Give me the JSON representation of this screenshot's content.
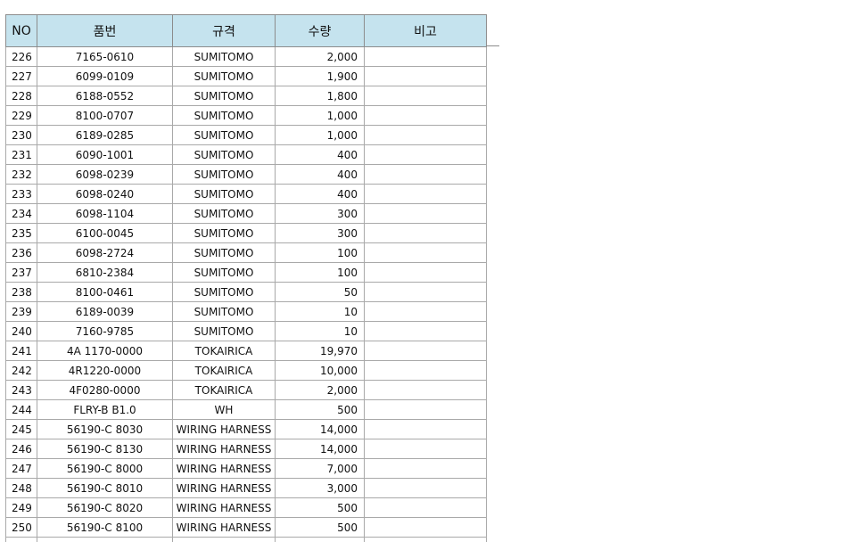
{
  "table": {
    "headers": {
      "no": "NO",
      "part": "품번",
      "spec": "규격",
      "qty": "수량",
      "note": "비고"
    },
    "rows": [
      {
        "no": "226",
        "part": "7165-0610",
        "spec": "SUMITOMO",
        "qty": "2,000",
        "note": ""
      },
      {
        "no": "227",
        "part": "6099-0109",
        "spec": "SUMITOMO",
        "qty": "1,900",
        "note": ""
      },
      {
        "no": "228",
        "part": "6188-0552",
        "spec": "SUMITOMO",
        "qty": "1,800",
        "note": ""
      },
      {
        "no": "229",
        "part": "8100-0707",
        "spec": "SUMITOMO",
        "qty": "1,000",
        "note": ""
      },
      {
        "no": "230",
        "part": "6189-0285",
        "spec": "SUMITOMO",
        "qty": "1,000",
        "note": ""
      },
      {
        "no": "231",
        "part": "6090-1001",
        "spec": "SUMITOMO",
        "qty": "400",
        "note": ""
      },
      {
        "no": "232",
        "part": "6098-0239",
        "spec": "SUMITOMO",
        "qty": "400",
        "note": ""
      },
      {
        "no": "233",
        "part": "6098-0240",
        "spec": "SUMITOMO",
        "qty": "400",
        "note": ""
      },
      {
        "no": "234",
        "part": "6098-1104",
        "spec": "SUMITOMO",
        "qty": "300",
        "note": ""
      },
      {
        "no": "235",
        "part": "6100-0045",
        "spec": "SUMITOMO",
        "qty": "300",
        "note": ""
      },
      {
        "no": "236",
        "part": "6098-2724",
        "spec": "SUMITOMO",
        "qty": "100",
        "note": ""
      },
      {
        "no": "237",
        "part": "6810-2384",
        "spec": "SUMITOMO",
        "qty": "100",
        "note": ""
      },
      {
        "no": "238",
        "part": "8100-0461",
        "spec": "SUMITOMO",
        "qty": "50",
        "note": ""
      },
      {
        "no": "239",
        "part": "6189-0039",
        "spec": "SUMITOMO",
        "qty": "10",
        "note": ""
      },
      {
        "no": "240",
        "part": "7160-9785",
        "spec": "SUMITOMO",
        "qty": "10",
        "note": ""
      },
      {
        "no": "241",
        "part": "4A 1170-0000",
        "spec": "TOKAIRICA",
        "qty": "19,970",
        "note": ""
      },
      {
        "no": "242",
        "part": "4R1220-0000",
        "spec": "TOKAIRICA",
        "qty": "10,000",
        "note": ""
      },
      {
        "no": "243",
        "part": "4F0280-0000",
        "spec": "TOKAIRICA",
        "qty": "2,000",
        "note": ""
      },
      {
        "no": "244",
        "part": "FLRY-B B1.0",
        "spec": "WH",
        "qty": "500",
        "note": ""
      },
      {
        "no": "245",
        "part": "56190-C 8030",
        "spec": "WIRING HARNESS",
        "qty": "14,000",
        "note": ""
      },
      {
        "no": "246",
        "part": "56190-C 8130",
        "spec": "WIRING HARNESS",
        "qty": "14,000",
        "note": ""
      },
      {
        "no": "247",
        "part": "56190-C 8000",
        "spec": "WIRING HARNESS",
        "qty": "7,000",
        "note": ""
      },
      {
        "no": "248",
        "part": "56190-C 8010",
        "spec": "WIRING HARNESS",
        "qty": "3,000",
        "note": ""
      },
      {
        "no": "249",
        "part": "56190-C 8020",
        "spec": "WIRING HARNESS",
        "qty": "500",
        "note": ""
      },
      {
        "no": "250",
        "part": "56190-C 8100",
        "spec": "WIRING HARNESS",
        "qty": "500",
        "note": ""
      },
      {
        "no": "",
        "part": "",
        "spec": "",
        "qty": "",
        "note": ""
      }
    ]
  },
  "colors": {
    "header_background": "#c5e3ee",
    "grid_line": "#a9a9a9"
  }
}
